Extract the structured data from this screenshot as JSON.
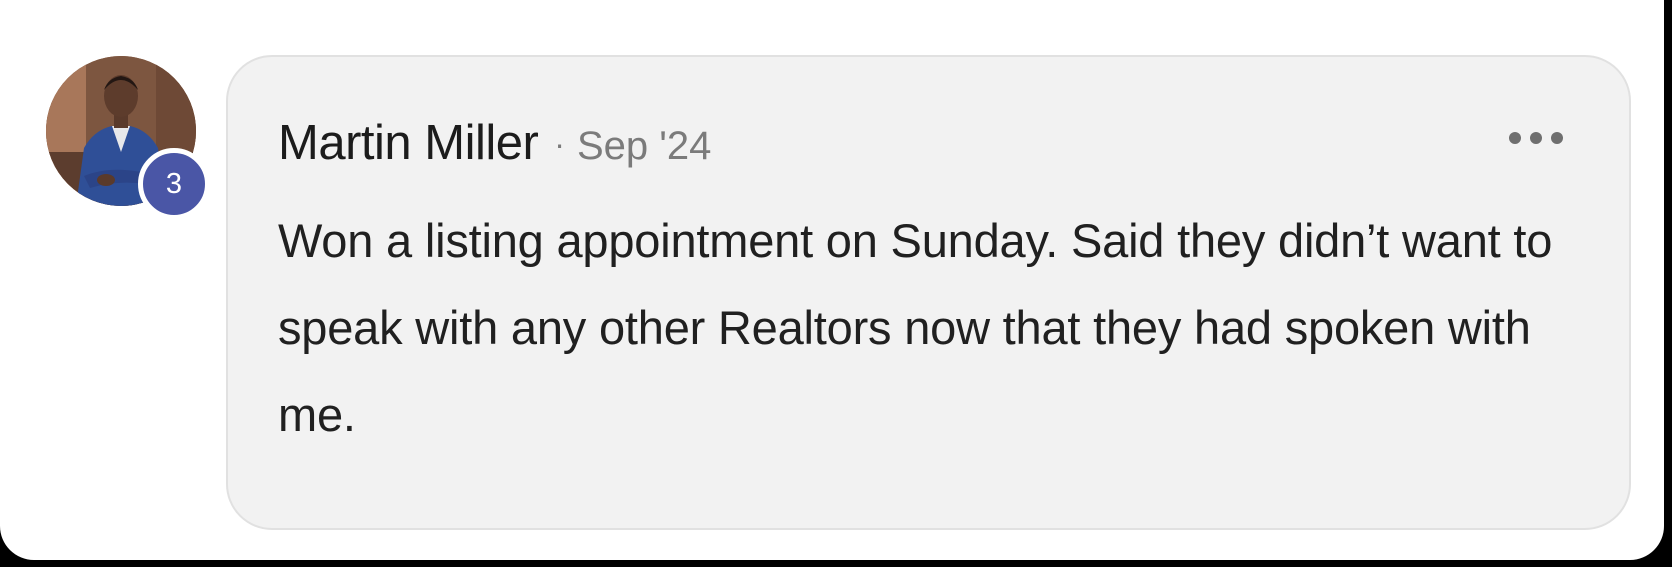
{
  "post": {
    "author_name": "Martin Miller",
    "separator": "·",
    "timestamp": "Sep '24",
    "badge_count": "3",
    "body_text": "Won a listing appointment on Sunday. Said they didn’t want to speak with any other Realtors now that they had spoken with me.",
    "more_icon": "more-horizontal-icon",
    "avatar_icon": "user-avatar-photo"
  },
  "colors": {
    "bubble_background": "#f2f2f2",
    "badge_background": "#4a56a6",
    "author_text": "#1c1c1c",
    "meta_text": "#7b7b7b"
  }
}
